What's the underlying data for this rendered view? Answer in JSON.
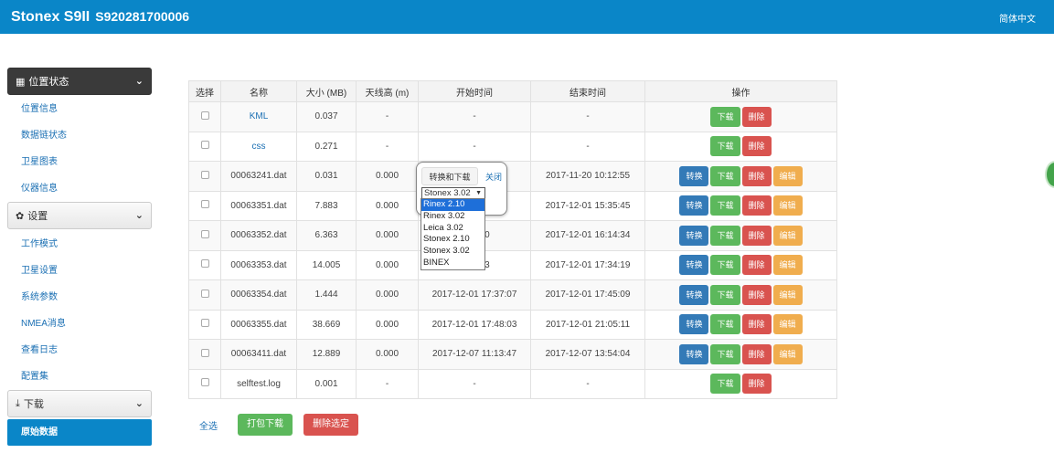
{
  "header": {
    "brand": "Stonex S9II",
    "serial": "S920281700006",
    "language": "简体中文"
  },
  "sidebar": {
    "sections": [
      {
        "title": "位置状态",
        "items": [
          "位置信息",
          "数据链状态",
          "卫星图表",
          "仪器信息"
        ]
      },
      {
        "title": "设置",
        "items": [
          "工作模式",
          "卫星设置",
          "系统参数",
          "NMEA消息",
          "查看日志",
          "配置集"
        ]
      },
      {
        "title": "下载",
        "items": [
          "原始数据"
        ]
      }
    ],
    "active_item": "原始数据"
  },
  "table": {
    "headers": [
      "选择",
      "名称",
      "大小 (MB)",
      "天线高 (m)",
      "开始时间",
      "结束时间",
      "操作"
    ],
    "rows": [
      {
        "name": "KML",
        "size": "0.037",
        "antenna": "-",
        "start": "-",
        "end": "-"
      },
      {
        "name": "css",
        "size": "0.271",
        "antenna": "-",
        "start": "-",
        "end": "-"
      },
      {
        "name": "00063241.dat",
        "size": "0.031",
        "antenna": "0.000",
        "start": ":44",
        "end": "2017-11-20 10:12:55"
      },
      {
        "name": "00063351.dat",
        "size": "7.883",
        "antenna": "0.000",
        "start": ":04",
        "end": "2017-12-01 15:35:45"
      },
      {
        "name": "00063352.dat",
        "size": "6.363",
        "antenna": "0.000",
        "start": "5:41:30",
        "end": "2017-12-01 16:14:34"
      },
      {
        "name": "00063353.dat",
        "size": "14.005",
        "antenna": "0.000",
        "start": "6:19:43",
        "end": "2017-12-01 17:34:19"
      },
      {
        "name": "00063354.dat",
        "size": "1.444",
        "antenna": "0.000",
        "start": "2017-12-01 17:37:07",
        "end": "2017-12-01 17:45:09"
      },
      {
        "name": "00063355.dat",
        "size": "38.669",
        "antenna": "0.000",
        "start": "2017-12-01 17:48:03",
        "end": "2017-12-01 21:05:11"
      },
      {
        "name": "00063411.dat",
        "size": "12.889",
        "antenna": "0.000",
        "start": "2017-12-07 11:13:47",
        "end": "2017-12-07 13:54:04"
      },
      {
        "name": "selftest.log",
        "size": "0.001",
        "antenna": "-",
        "start": "-",
        "end": "-"
      }
    ],
    "actions": {
      "convert": "转换",
      "download": "下载",
      "delete": "删除",
      "edit": "编辑"
    }
  },
  "popover": {
    "convert_download": "转换和下载",
    "close": "关闭",
    "selected": "Stonex 3.02",
    "options": [
      "Rinex 2.10",
      "Rinex 3.02",
      "Leica 3.02",
      "Stonex 2.10",
      "Stonex 3.02",
      "BINEX"
    ],
    "highlighted": "Rinex 2.10"
  },
  "bottom": {
    "select_all": "全选",
    "pack_download": "打包下载",
    "delete_selected": "删除选定"
  },
  "colors": {
    "header": "#0a86c8",
    "blue": "#337ab7",
    "green": "#5cb85c",
    "red": "#d9534f",
    "orange": "#f0ad4e"
  }
}
